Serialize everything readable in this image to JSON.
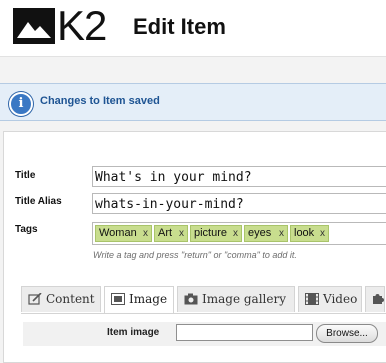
{
  "header": {
    "logo_text": "K2",
    "title": "Edit Item"
  },
  "message": {
    "text": "Changes to Item saved",
    "icon": "info-icon"
  },
  "form": {
    "title_label": "Title",
    "title_value": "What's in your mind?",
    "alias_label": "Title Alias",
    "alias_value": "whats-in-your-mind?",
    "tags_label": "Tags",
    "tags": [
      "Woman",
      "Art",
      "picture",
      "eyes",
      "look"
    ],
    "tag_remove": "x",
    "tags_hint": "Write a tag and press \"return\" or \"comma\" to add it."
  },
  "tabs": [
    {
      "label": "Content",
      "icon": "edit-icon"
    },
    {
      "label": "Image",
      "icon": "image-icon"
    },
    {
      "label": "Image gallery",
      "icon": "camera-icon"
    },
    {
      "label": "Video",
      "icon": "film-icon"
    }
  ],
  "image_tab": {
    "item_image_label": "Item image",
    "browse_label": "Browse..."
  },
  "colors": {
    "tag_bg": "#c8dd8e",
    "message_text": "#1e5493",
    "message_bg": "#e4eef8"
  }
}
